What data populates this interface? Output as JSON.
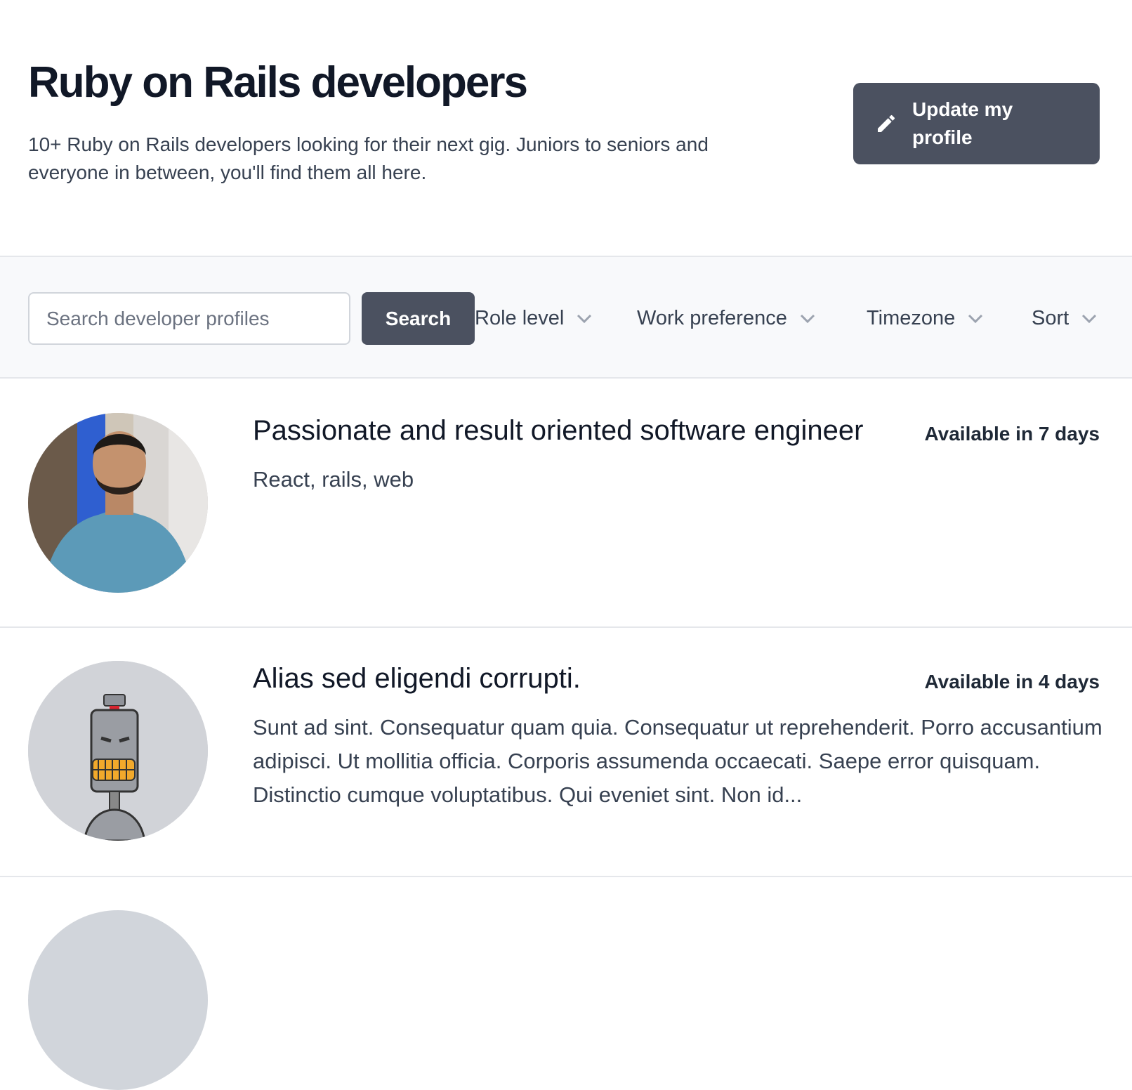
{
  "header": {
    "title": "Ruby on Rails developers",
    "description": "10+ Ruby on Rails developers looking for their next gig. Juniors to seniors and everyone in between, you'll find them all here.",
    "update_button": "Update my profile"
  },
  "filters": {
    "search_placeholder": "Search developer profiles",
    "search_button": "Search",
    "role_level": "Role level",
    "work_preference": "Work preference",
    "timezone": "Timezone",
    "sort": "Sort"
  },
  "developers": [
    {
      "title": "Passionate and result oriented software engineer",
      "availability": "Available in 7 days",
      "bio": "React, rails, web"
    },
    {
      "title": "Alias sed eligendi corrupti.",
      "availability": "Available in 4 days",
      "bio": "Sunt ad sint. Consequatur quam quia. Consequatur ut reprehenderit. Porro accusantium adipisci. Ut mollitia officia. Corporis assumenda occaecati. Saepe error quisquam. Distinctio cumque voluptatibus. Qui eveniet sint. Non id..."
    }
  ],
  "colors": {
    "primary_button": "#4b5160",
    "filterbar_bg": "#f8f9fb",
    "border": "#e5e7eb"
  }
}
